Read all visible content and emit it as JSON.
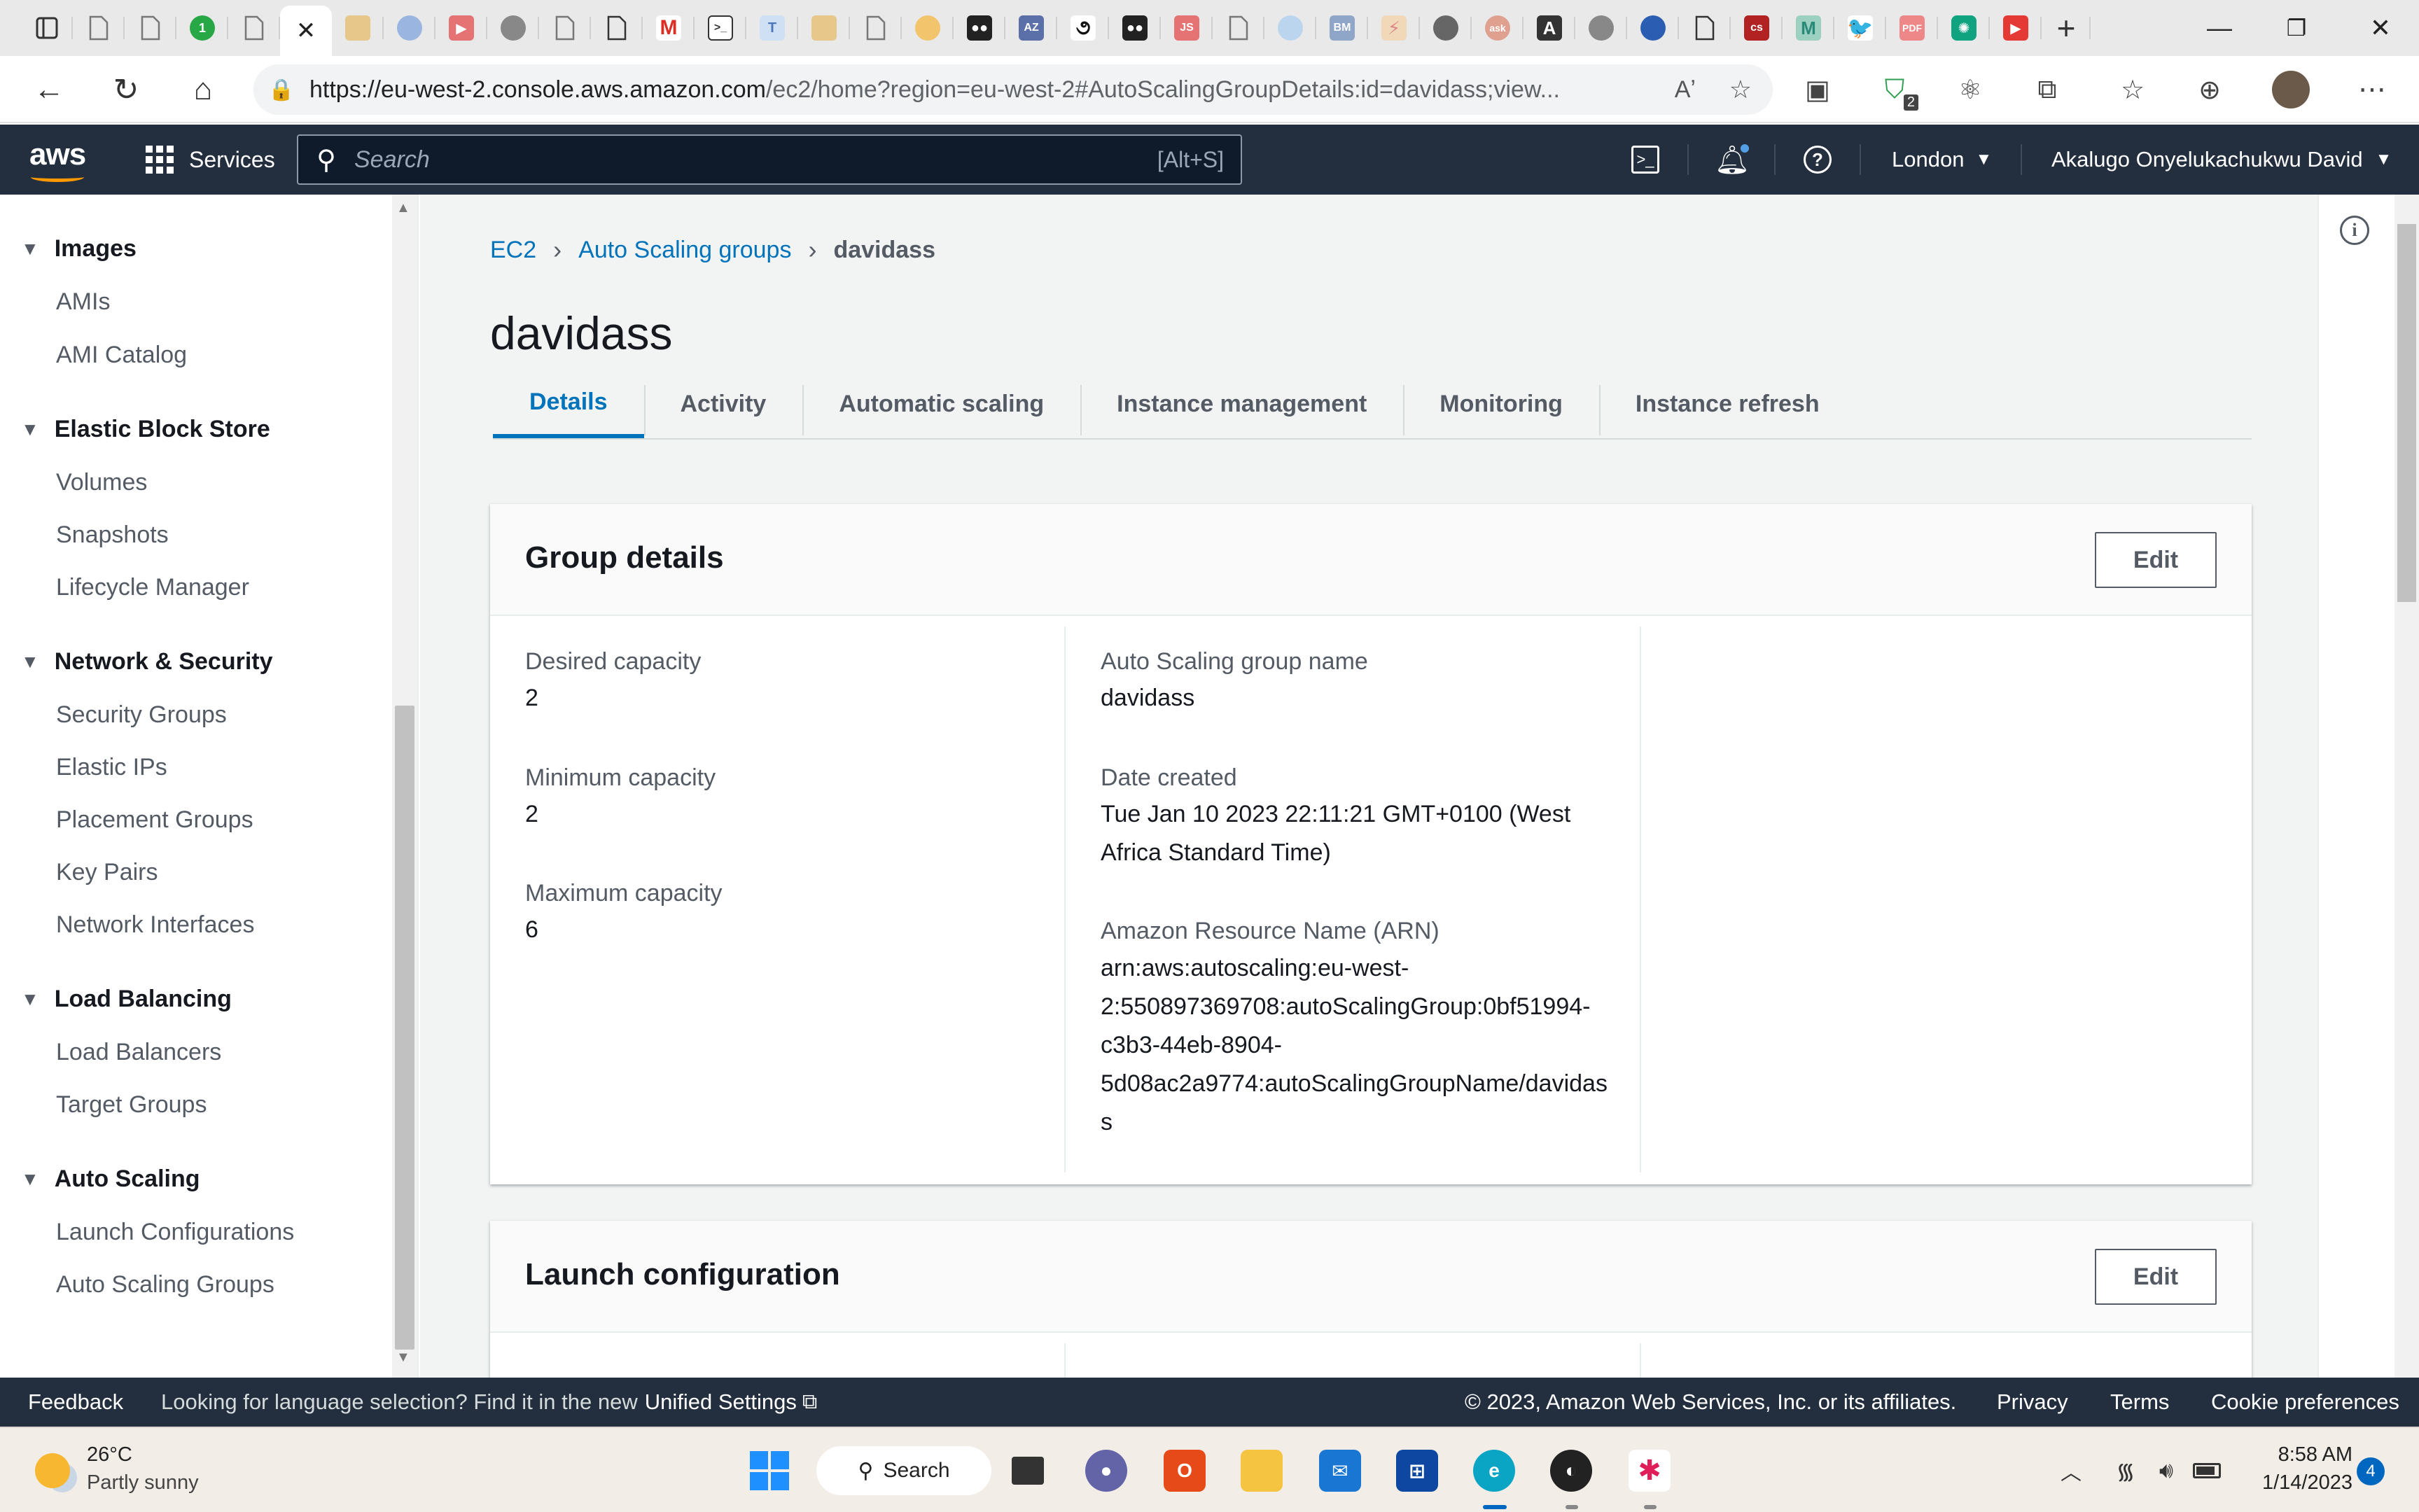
{
  "browser": {
    "url_host": "https://eu-west-2.console.aws.amazon.com",
    "url_rest": "/ec2/home?region=eu-west-2#AutoScalingGroupDetails:id=davidass;view...",
    "extension_badge": "2"
  },
  "aws_nav": {
    "services_label": "Services",
    "search_placeholder": "Search",
    "search_shortcut": "[Alt+S]",
    "region": "London",
    "user": "Akalugo Onyelukachukwu David"
  },
  "sidebar": {
    "sections": [
      {
        "title": "Images",
        "items": [
          "AMIs",
          "AMI Catalog"
        ]
      },
      {
        "title": "Elastic Block Store",
        "items": [
          "Volumes",
          "Snapshots",
          "Lifecycle Manager"
        ]
      },
      {
        "title": "Network & Security",
        "items": [
          "Security Groups",
          "Elastic IPs",
          "Placement Groups",
          "Key Pairs",
          "Network Interfaces"
        ]
      },
      {
        "title": "Load Balancing",
        "items": [
          "Load Balancers",
          "Target Groups"
        ]
      },
      {
        "title": "Auto Scaling",
        "items": [
          "Launch Configurations",
          "Auto Scaling Groups"
        ]
      }
    ]
  },
  "breadcrumb": [
    "EC2",
    "Auto Scaling groups",
    "davidass"
  ],
  "page_title": "davidass",
  "tabs": [
    "Details",
    "Activity",
    "Automatic scaling",
    "Instance management",
    "Monitoring",
    "Instance refresh"
  ],
  "group_details": {
    "title": "Group details",
    "edit_label": "Edit",
    "desired_label": "Desired capacity",
    "desired_value": "2",
    "min_label": "Minimum capacity",
    "min_value": "2",
    "max_label": "Maximum capacity",
    "max_value": "6",
    "name_label": "Auto Scaling group name",
    "name_value": "davidass",
    "date_label": "Date created",
    "date_value_1": "Tue Jan 10 2023 22:11:21 GMT+0100 (West",
    "date_value_2": "Africa Standard Time)",
    "arn_label": "Amazon Resource Name (ARN)",
    "arn_lines": [
      "arn:aws:autoscaling:eu-west-",
      "2:550897369708:autoScalingGroup:0bf51994-",
      "c3b3-44eb-8904-",
      "5d08ac2a9774:autoScalingGroupName/davidas",
      "s"
    ]
  },
  "launch_config": {
    "title": "Launch configuration",
    "edit_label": "Edit"
  },
  "footer": {
    "feedback": "Feedback",
    "lang_msg": "Looking for language selection? Find it in the new",
    "lang_link": "Unified Settings",
    "copyright": "© 2023, Amazon Web Services, Inc. or its affiliates.",
    "privacy": "Privacy",
    "terms": "Terms",
    "cookies": "Cookie preferences"
  },
  "taskbar": {
    "temp": "26°C",
    "weather": "Partly sunny",
    "search_label": "Search",
    "time": "8:58 AM",
    "date": "1/14/2023",
    "notif_count": "4"
  },
  "colors": {
    "aws_dark": "#232f3e",
    "aws_orange": "#ff9900",
    "link_blue": "#0073bb"
  }
}
